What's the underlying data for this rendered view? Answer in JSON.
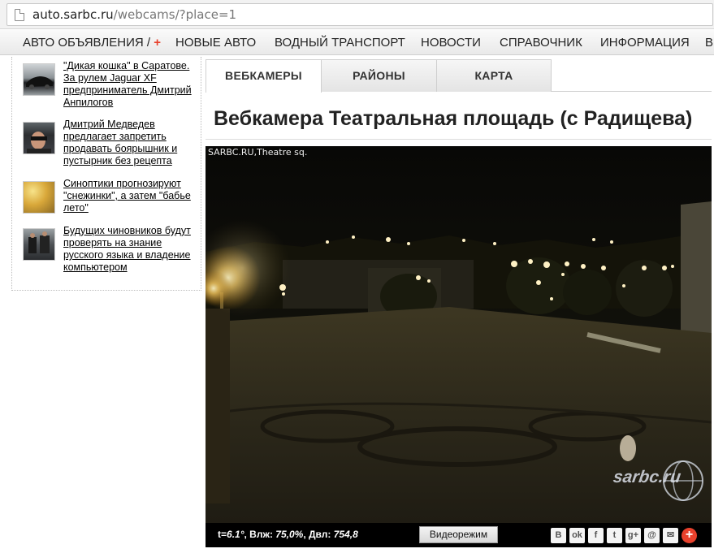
{
  "browser": {
    "url_host": "auto.sarbc.ru",
    "url_path": "/webcams/?place=1"
  },
  "nav": {
    "items": [
      {
        "label": "АВТО ОБЪЯВЛЕНИЯ /",
        "plus": "+"
      },
      {
        "label": "НОВЫЕ АВТО"
      },
      {
        "label": "ВОДНЫЙ ТРАНСПОРТ"
      },
      {
        "label": "НОВОСТИ"
      },
      {
        "label": "СПРАВОЧНИК"
      },
      {
        "label": "ИНФОРМАЦИЯ"
      },
      {
        "label": "В"
      }
    ]
  },
  "sidebar": {
    "news": [
      {
        "title": "\"Дикая кошка\" в Саратове. За рулем Jaguar XF предприниматель Дмитрий Анпилогов"
      },
      {
        "title": "Дмитрий Медведев предлагает запретить продавать боярышник и пустырник без рецепта"
      },
      {
        "title": "Синоптики прогнозируют \"снежинки\", а затем \"бабье лето\""
      },
      {
        "title": "Будущих чиновников будут проверять на знание русского языка и владение компьютером"
      }
    ]
  },
  "tabs": [
    {
      "label": "ВЕБКАМЕРЫ",
      "active": true
    },
    {
      "label": "РАЙОНЫ",
      "active": false
    },
    {
      "label": "КАРТА",
      "active": false
    }
  ],
  "page_title": "Вебкамера Театральная площадь (с Радищева)",
  "webcam": {
    "overlay_label": "SARBC.RU,Theatre sq.",
    "watermark": "sarbc.ru"
  },
  "infobar": {
    "t_label": "t=",
    "t_value": "6.1°",
    "hum_label": ", Влж: ",
    "hum_value": "75,0%",
    "pres_label": ", Двл: ",
    "pres_value": "754,8",
    "video_button": "Видеорежим"
  },
  "share": [
    {
      "icon": "vk-icon",
      "glyph": "B"
    },
    {
      "icon": "odnoklassniki-icon",
      "glyph": "ok"
    },
    {
      "icon": "facebook-icon",
      "glyph": "f"
    },
    {
      "icon": "twitter-icon",
      "glyph": "t"
    },
    {
      "icon": "google-plus-icon",
      "glyph": "g+"
    },
    {
      "icon": "mailru-icon",
      "glyph": "@"
    },
    {
      "icon": "email-icon",
      "glyph": "✉"
    },
    {
      "icon": "more-share-icon",
      "glyph": "+"
    }
  ],
  "colors": {
    "accent_plus": "#e8412c",
    "camera_bg": "#0e0d08"
  }
}
